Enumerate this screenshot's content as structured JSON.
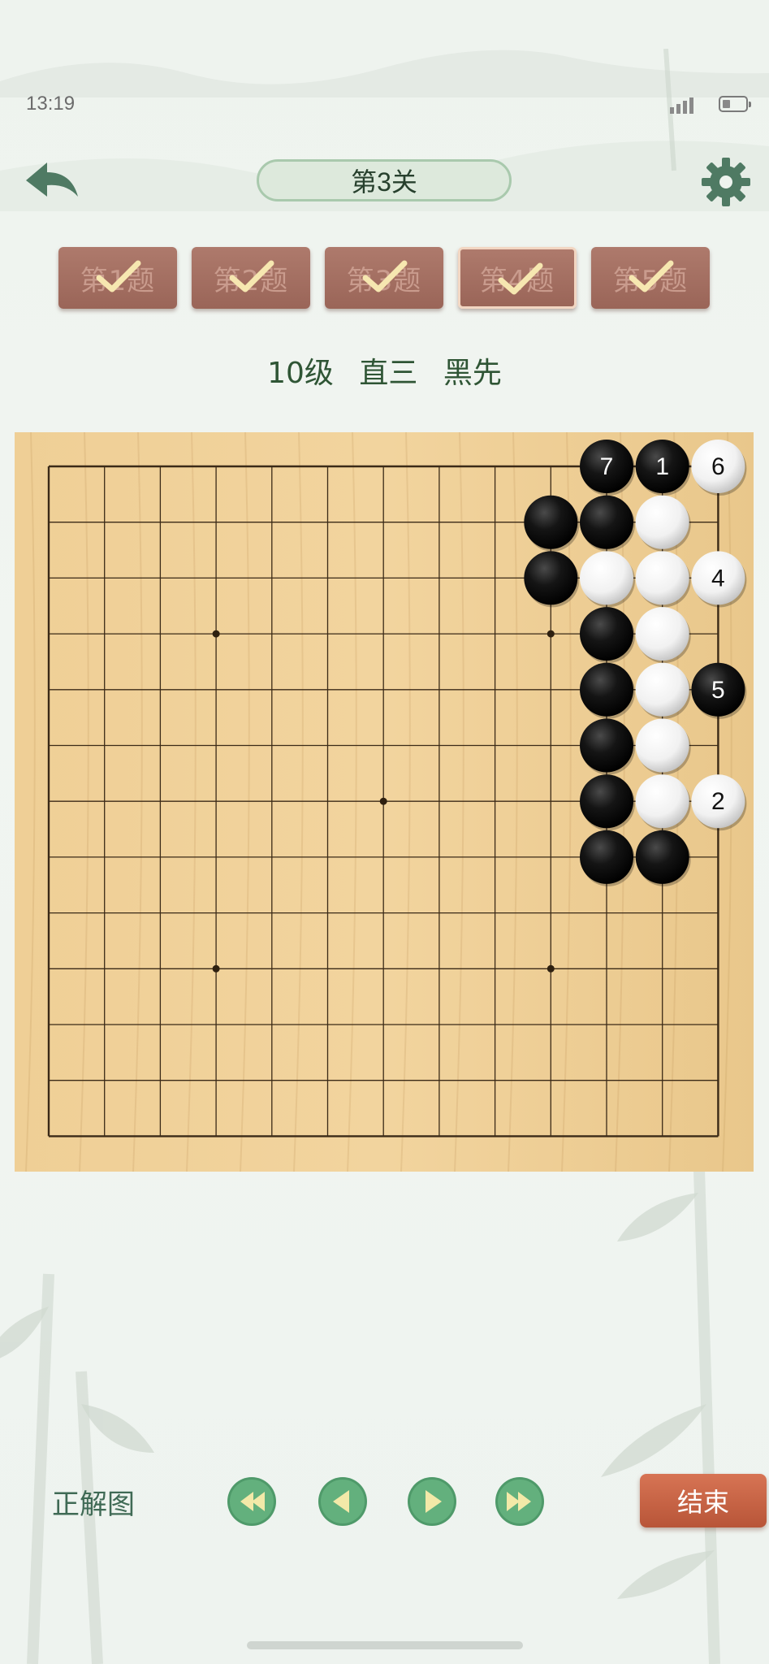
{
  "status_bar": {
    "time": "13:19"
  },
  "header": {
    "level_title": "第3关"
  },
  "tabs": [
    {
      "label": "第1题",
      "completed": true,
      "active": false
    },
    {
      "label": "第2题",
      "completed": true,
      "active": false
    },
    {
      "label": "第3题",
      "completed": true,
      "active": false
    },
    {
      "label": "第4题",
      "completed": true,
      "active": true
    },
    {
      "label": "第5题",
      "completed": true,
      "active": false
    }
  ],
  "problem": {
    "rank": "10级",
    "name": "直三",
    "first": "黑先"
  },
  "board": {
    "size": 13,
    "star_points": [
      [
        3,
        3
      ],
      [
        9,
        3
      ],
      [
        6,
        6
      ],
      [
        3,
        9
      ],
      [
        9,
        9
      ]
    ],
    "stones": [
      {
        "col": 10,
        "row": 0,
        "color": "black",
        "label": "7"
      },
      {
        "col": 11,
        "row": 0,
        "color": "black",
        "label": "1"
      },
      {
        "col": 12,
        "row": 0,
        "color": "white",
        "label": "6"
      },
      {
        "col": 9,
        "row": 1,
        "color": "black",
        "label": ""
      },
      {
        "col": 10,
        "row": 1,
        "color": "black",
        "label": ""
      },
      {
        "col": 11,
        "row": 1,
        "color": "white",
        "label": ""
      },
      {
        "col": 9,
        "row": 2,
        "color": "black",
        "label": ""
      },
      {
        "col": 10,
        "row": 2,
        "color": "white",
        "label": ""
      },
      {
        "col": 11,
        "row": 2,
        "color": "white",
        "label": ""
      },
      {
        "col": 12,
        "row": 2,
        "color": "white",
        "label": "4"
      },
      {
        "col": 10,
        "row": 3,
        "color": "black",
        "label": ""
      },
      {
        "col": 11,
        "row": 3,
        "color": "white",
        "label": ""
      },
      {
        "col": 10,
        "row": 4,
        "color": "black",
        "label": ""
      },
      {
        "col": 11,
        "row": 4,
        "color": "white",
        "label": ""
      },
      {
        "col": 12,
        "row": 4,
        "color": "black",
        "label": "5"
      },
      {
        "col": 10,
        "row": 5,
        "color": "black",
        "label": ""
      },
      {
        "col": 11,
        "row": 5,
        "color": "white",
        "label": ""
      },
      {
        "col": 10,
        "row": 6,
        "color": "black",
        "label": ""
      },
      {
        "col": 11,
        "row": 6,
        "color": "white",
        "label": ""
      },
      {
        "col": 12,
        "row": 6,
        "color": "white",
        "label": "2"
      },
      {
        "col": 10,
        "row": 7,
        "color": "black",
        "label": ""
      },
      {
        "col": 11,
        "row": 7,
        "color": "black",
        "label": ""
      }
    ]
  },
  "footer": {
    "solution_label": "正解图",
    "end_label": "结束",
    "nav_buttons": [
      "first-move",
      "previous-move",
      "next-move",
      "last-move"
    ]
  },
  "colors": {
    "accent_green": "#2f5535",
    "tab_brown": "#a36e61",
    "end_button": "#c8603f",
    "board_wood": "#eccb8f"
  }
}
